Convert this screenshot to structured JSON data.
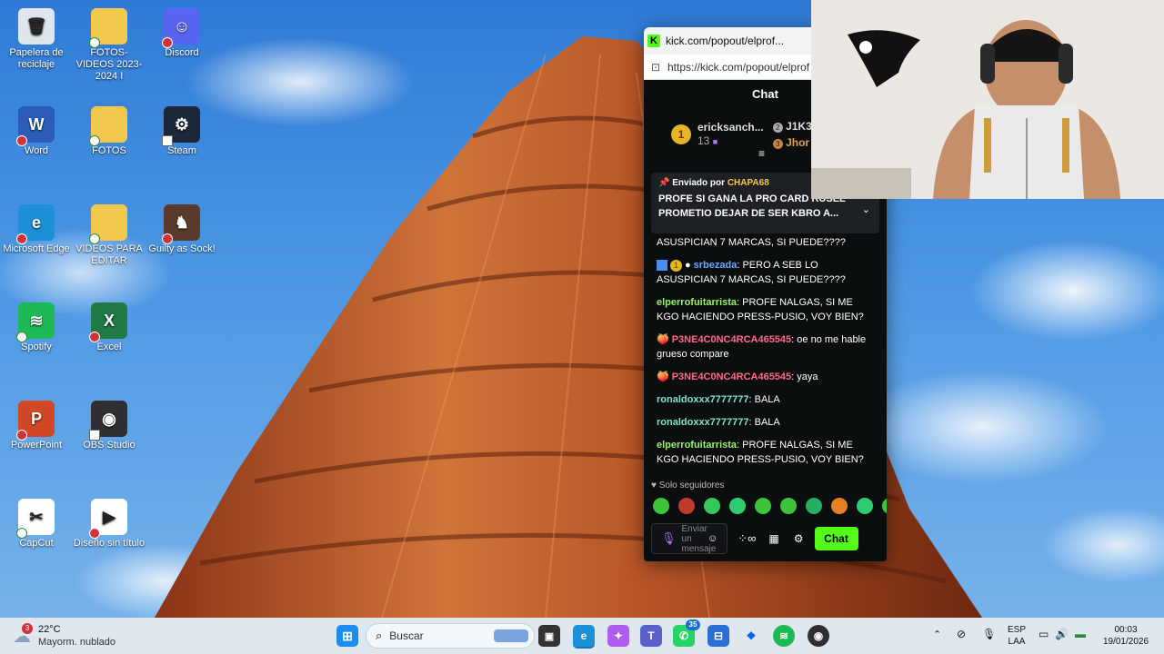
{
  "desktop": {
    "icons": [
      {
        "label": "Papelera de reciclaje",
        "icon": "recycle-bin-icon",
        "color": "#dfe6ee",
        "glyph": "🗑"
      },
      {
        "label": "FOTOS- VIDEOS 2023-2024 I",
        "icon": "folder-icon",
        "color": "#f2c94c",
        "glyph": ""
      },
      {
        "label": "Discord",
        "icon": "discord-icon",
        "color": "#5865f2",
        "glyph": "☺"
      },
      {
        "label": "Word",
        "icon": "word-icon",
        "color": "#2b5cb8",
        "glyph": "W"
      },
      {
        "label": "FOTOS",
        "icon": "folder-icon",
        "color": "#f2c94c",
        "glyph": ""
      },
      {
        "label": "Steam",
        "icon": "steam-icon",
        "color": "#1b2838",
        "glyph": "⚙"
      },
      {
        "label": "Microsoft Edge",
        "icon": "edge-icon",
        "color": "#1c8fd6",
        "glyph": "e"
      },
      {
        "label": "VIDEOS PARA EDITAR",
        "icon": "folder-icon",
        "color": "#f2c94c",
        "glyph": ""
      },
      {
        "label": "Guilty as Sock!",
        "icon": "game-icon",
        "color": "#5a3a2a",
        "glyph": "♞"
      },
      {
        "label": "Spotify",
        "icon": "spotify-icon",
        "color": "#1db954",
        "glyph": "≋"
      },
      {
        "label": "Excel",
        "icon": "excel-icon",
        "color": "#1f7a45",
        "glyph": "X"
      },
      {
        "label": "PowerPoint",
        "icon": "powerpoint-icon",
        "color": "#d24726",
        "glyph": "P"
      },
      {
        "label": "OBS Studio",
        "icon": "obs-icon",
        "color": "#302e31",
        "glyph": "◉"
      },
      {
        "label": "CapCut",
        "icon": "capcut-icon",
        "color": "#ffffff",
        "glyph": "✂"
      },
      {
        "label": "Diseño sin título",
        "icon": "video-file-icon",
        "color": "#ffffff",
        "glyph": "▶"
      }
    ]
  },
  "popout": {
    "tab_title": "kick.com/popout/elprof...",
    "minimize": "–",
    "url": "https://kick.com/popout/elprof",
    "header": "Chat",
    "leaderboard": [
      {
        "rank": "1",
        "name": "ericksanch...",
        "count": "13"
      },
      {
        "rank": "2",
        "name": "J1K3"
      },
      {
        "rank": "3",
        "name": "Jhor"
      }
    ],
    "pinned": {
      "sent_by_label": "Enviado por",
      "sent_by_user": "CHAPA68",
      "text": "PROFE SI GANA LA PRO CARD RUSEL PROMETIO DEJAR DE SER KBRO A..."
    },
    "messages": [
      {
        "user": "",
        "text": "ASUSPICIAN 7 MARCAS, SI PUEDE????",
        "cls": ""
      },
      {
        "user": "srbezada",
        "text": ": PERO A SEB LO ASUSPICIAN 7 MARCAS, SI PUEDE????",
        "cls": "u-blue",
        "badge": "1"
      },
      {
        "user": "elperrofuitarrista",
        "text": ": PROFE NALGAS, SI ME KGO HACIENDO PRESS-PUSIO, VOY BIEN?",
        "cls": "u-green"
      },
      {
        "user": "P3NE4C0NC4RCA465545",
        "text": ": oe no me hable grueso compare",
        "cls": "u-pink",
        "emoji": "🍑"
      },
      {
        "user": "P3NE4C0NC4RCA465545",
        "text": ": yaya",
        "cls": "u-pink",
        "emoji": "🍑"
      },
      {
        "user": "ronaldoxxx7777777",
        "text": ": BALA",
        "cls": "u-teal"
      },
      {
        "user": "ronaldoxxx7777777",
        "text": ": BALA",
        "cls": "u-teal"
      },
      {
        "user": "elperrofuitarrista",
        "text": ": PROFE NALGAS, SI ME KGO HACIENDO PRESS-PUSIO, VOY BIEN?",
        "cls": "u-green"
      }
    ],
    "followers_only": "Solo seguidores",
    "input_placeholder": "Enviar un mensaje",
    "chat_button": "Chat",
    "accent": "#53fc18"
  },
  "taskbar": {
    "weather_temp": "22°C",
    "weather_desc": "Mayorm. nublado",
    "weather_badge": "3",
    "search_label": "Buscar",
    "whatsapp_badge": "35",
    "lang_top": "ESP",
    "lang_bottom": "LAA",
    "time": "00:03",
    "date": "19/01/2026"
  }
}
